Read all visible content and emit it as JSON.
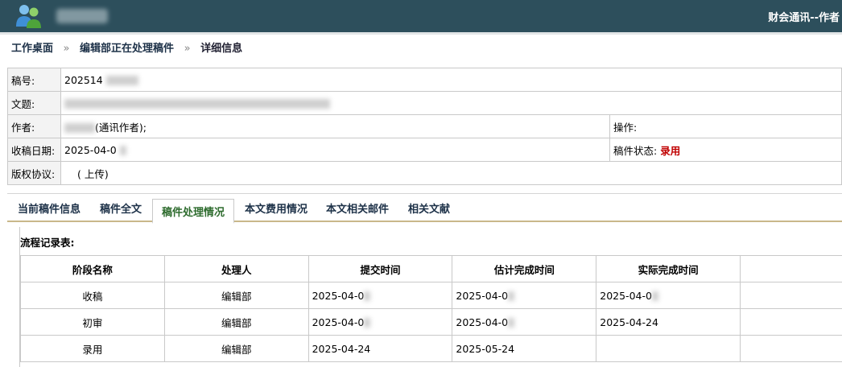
{
  "header": {
    "system_name": "财会通讯--作者"
  },
  "breadcrumb": {
    "home": "工作桌面",
    "separator": "»",
    "middle": "编辑部正在处理稿件",
    "current": "详细信息"
  },
  "manuscript": {
    "number_label": "稿号:",
    "number_value": "202514",
    "title_label": "文题:",
    "title_value": "",
    "author_label": "作者:",
    "author_value": "(通讯作者);",
    "operation_label": "操作:",
    "received_label": "收稿日期:",
    "received_value": "2025-04-0",
    "status_label": "稿件状态:",
    "status_value": "录用",
    "copyright_label": "版权协议:",
    "copyright_value": "( 上传)"
  },
  "tabs": [
    {
      "label": "当前稿件信息"
    },
    {
      "label": "稿件全文"
    },
    {
      "label": "稿件处理情况",
      "active": true
    },
    {
      "label": "本文费用情况"
    },
    {
      "label": "本文相关邮件"
    },
    {
      "label": "相关文献"
    }
  ],
  "flow": {
    "title": "流程记录表:",
    "columns": [
      "阶段名称",
      "处理人",
      "提交时间",
      "估计完成时间",
      "实际完成时间",
      ""
    ],
    "rows": [
      [
        "收稿",
        "编辑部",
        "2025-04-0",
        "2025-04-0",
        "2025-04-0",
        ""
      ],
      [
        "初审",
        "编辑部",
        "2025-04-0",
        "2025-04-0",
        "2025-04-24",
        ""
      ],
      [
        "录用",
        "编辑部",
        "2025-04-24",
        "2025-05-24",
        "",
        ""
      ]
    ]
  },
  "colors": {
    "header_bg": "#2d4f5c",
    "status_red": "#c00000",
    "active_tab_green": "#2d6b2d"
  }
}
